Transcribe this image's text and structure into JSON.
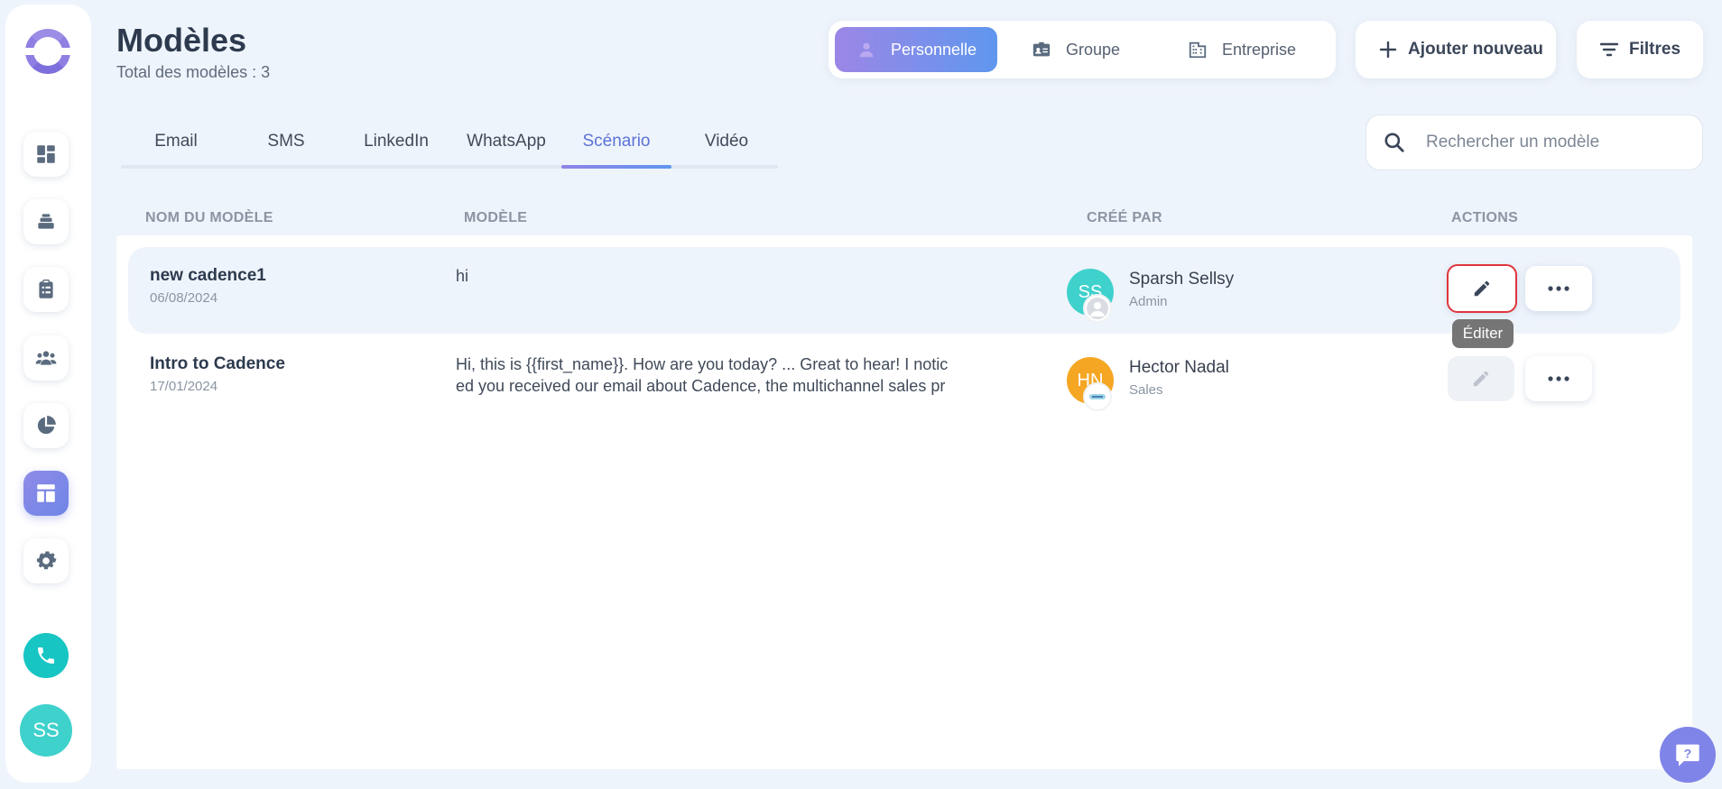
{
  "header": {
    "title": "Modèles",
    "subtitle": "Total des modèles : 3"
  },
  "scopes": [
    {
      "label": "Personnelle",
      "active": true
    },
    {
      "label": "Groupe",
      "active": false
    },
    {
      "label": "Entreprise",
      "active": false
    }
  ],
  "actions": {
    "add_label": "Ajouter nouveau",
    "filter_label": "Filtres"
  },
  "tabs": [
    "Email",
    "SMS",
    "LinkedIn",
    "WhatsApp",
    "Scénario",
    "Vidéo"
  ],
  "active_tab": "Scénario",
  "search": {
    "placeholder": "Rechercher un modèle"
  },
  "columns": {
    "name": "NOM DU MODÈLE",
    "model": "MODÈLE",
    "created_by": "CRÉÉ PAR",
    "actions": "ACTIONS"
  },
  "rows": [
    {
      "name": "new cadence1",
      "date": "06/08/2024",
      "model": "hi",
      "initials": "SS",
      "person": "Sparsh Sellsy",
      "role": "Admin"
    },
    {
      "name": "Intro to Cadence",
      "date": "17/01/2024",
      "model": "Hi, this is {{first_name}}. How are you today? ... Great to hear! I noticed you received our email about Cadence, the multichannel sales prospecting tool. Did you...",
      "initials": "HN",
      "person": "Hector Nadal",
      "role": "Sales"
    }
  ],
  "tooltip": "Éditer",
  "sidebar": {
    "user_initials": "SS"
  },
  "colors": {
    "accent": "#5b72d9",
    "teal": "#3fd1cc",
    "orange": "#f5a623",
    "focus_red": "#e0353b"
  }
}
